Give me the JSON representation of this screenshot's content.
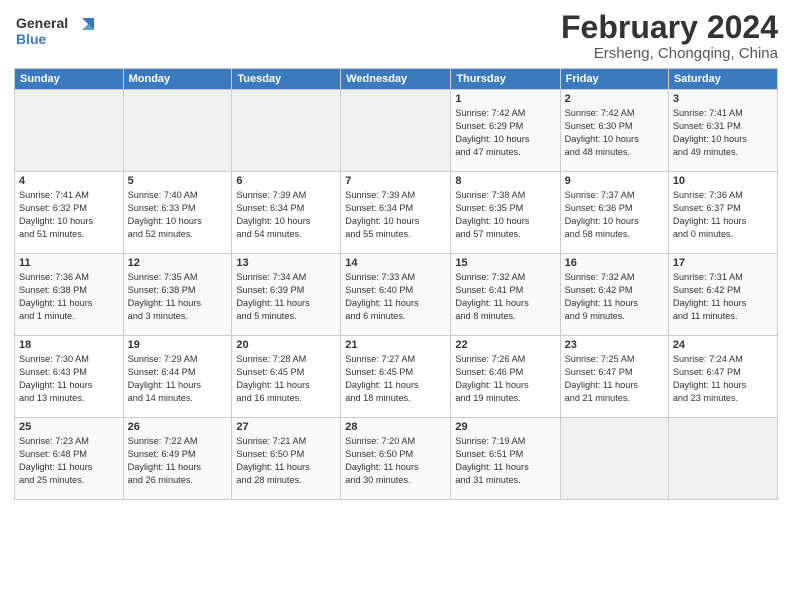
{
  "logo": {
    "line1": "General",
    "line2": "Blue"
  },
  "title": "February 2024",
  "location": "Ersheng, Chongqing, China",
  "days_of_week": [
    "Sunday",
    "Monday",
    "Tuesday",
    "Wednesday",
    "Thursday",
    "Friday",
    "Saturday"
  ],
  "weeks": [
    [
      {
        "num": "",
        "info": ""
      },
      {
        "num": "",
        "info": ""
      },
      {
        "num": "",
        "info": ""
      },
      {
        "num": "",
        "info": ""
      },
      {
        "num": "1",
        "info": "Sunrise: 7:42 AM\nSunset: 6:29 PM\nDaylight: 10 hours\nand 47 minutes."
      },
      {
        "num": "2",
        "info": "Sunrise: 7:42 AM\nSunset: 6:30 PM\nDaylight: 10 hours\nand 48 minutes."
      },
      {
        "num": "3",
        "info": "Sunrise: 7:41 AM\nSunset: 6:31 PM\nDaylight: 10 hours\nand 49 minutes."
      }
    ],
    [
      {
        "num": "4",
        "info": "Sunrise: 7:41 AM\nSunset: 6:32 PM\nDaylight: 10 hours\nand 51 minutes."
      },
      {
        "num": "5",
        "info": "Sunrise: 7:40 AM\nSunset: 6:33 PM\nDaylight: 10 hours\nand 52 minutes."
      },
      {
        "num": "6",
        "info": "Sunrise: 7:39 AM\nSunset: 6:34 PM\nDaylight: 10 hours\nand 54 minutes."
      },
      {
        "num": "7",
        "info": "Sunrise: 7:39 AM\nSunset: 6:34 PM\nDaylight: 10 hours\nand 55 minutes."
      },
      {
        "num": "8",
        "info": "Sunrise: 7:38 AM\nSunset: 6:35 PM\nDaylight: 10 hours\nand 57 minutes."
      },
      {
        "num": "9",
        "info": "Sunrise: 7:37 AM\nSunset: 6:36 PM\nDaylight: 10 hours\nand 58 minutes."
      },
      {
        "num": "10",
        "info": "Sunrise: 7:36 AM\nSunset: 6:37 PM\nDaylight: 11 hours\nand 0 minutes."
      }
    ],
    [
      {
        "num": "11",
        "info": "Sunrise: 7:36 AM\nSunset: 6:38 PM\nDaylight: 11 hours\nand 1 minute."
      },
      {
        "num": "12",
        "info": "Sunrise: 7:35 AM\nSunset: 6:38 PM\nDaylight: 11 hours\nand 3 minutes."
      },
      {
        "num": "13",
        "info": "Sunrise: 7:34 AM\nSunset: 6:39 PM\nDaylight: 11 hours\nand 5 minutes."
      },
      {
        "num": "14",
        "info": "Sunrise: 7:33 AM\nSunset: 6:40 PM\nDaylight: 11 hours\nand 6 minutes."
      },
      {
        "num": "15",
        "info": "Sunrise: 7:32 AM\nSunset: 6:41 PM\nDaylight: 11 hours\nand 8 minutes."
      },
      {
        "num": "16",
        "info": "Sunrise: 7:32 AM\nSunset: 6:42 PM\nDaylight: 11 hours\nand 9 minutes."
      },
      {
        "num": "17",
        "info": "Sunrise: 7:31 AM\nSunset: 6:42 PM\nDaylight: 11 hours\nand 11 minutes."
      }
    ],
    [
      {
        "num": "18",
        "info": "Sunrise: 7:30 AM\nSunset: 6:43 PM\nDaylight: 11 hours\nand 13 minutes."
      },
      {
        "num": "19",
        "info": "Sunrise: 7:29 AM\nSunset: 6:44 PM\nDaylight: 11 hours\nand 14 minutes."
      },
      {
        "num": "20",
        "info": "Sunrise: 7:28 AM\nSunset: 6:45 PM\nDaylight: 11 hours\nand 16 minutes."
      },
      {
        "num": "21",
        "info": "Sunrise: 7:27 AM\nSunset: 6:45 PM\nDaylight: 11 hours\nand 18 minutes."
      },
      {
        "num": "22",
        "info": "Sunrise: 7:26 AM\nSunset: 6:46 PM\nDaylight: 11 hours\nand 19 minutes."
      },
      {
        "num": "23",
        "info": "Sunrise: 7:25 AM\nSunset: 6:47 PM\nDaylight: 11 hours\nand 21 minutes."
      },
      {
        "num": "24",
        "info": "Sunrise: 7:24 AM\nSunset: 6:47 PM\nDaylight: 11 hours\nand 23 minutes."
      }
    ],
    [
      {
        "num": "25",
        "info": "Sunrise: 7:23 AM\nSunset: 6:48 PM\nDaylight: 11 hours\nand 25 minutes."
      },
      {
        "num": "26",
        "info": "Sunrise: 7:22 AM\nSunset: 6:49 PM\nDaylight: 11 hours\nand 26 minutes."
      },
      {
        "num": "27",
        "info": "Sunrise: 7:21 AM\nSunset: 6:50 PM\nDaylight: 11 hours\nand 28 minutes."
      },
      {
        "num": "28",
        "info": "Sunrise: 7:20 AM\nSunset: 6:50 PM\nDaylight: 11 hours\nand 30 minutes."
      },
      {
        "num": "29",
        "info": "Sunrise: 7:19 AM\nSunset: 6:51 PM\nDaylight: 11 hours\nand 31 minutes."
      },
      {
        "num": "",
        "info": ""
      },
      {
        "num": "",
        "info": ""
      }
    ]
  ]
}
